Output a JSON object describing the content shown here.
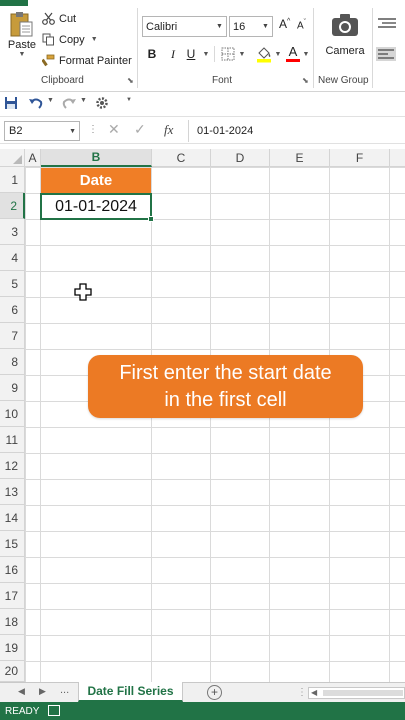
{
  "ribbon": {
    "clipboard": {
      "paste_label": "Paste",
      "cut_label": "Cut",
      "copy_label": "Copy",
      "format_painter_label": "Format Painter",
      "group_label": "Clipboard"
    },
    "font": {
      "font_name": "Calibri",
      "font_size": "16",
      "bold_label": "B",
      "italic_label": "I",
      "underline_label": "U",
      "grow_label": "A",
      "shrink_label": "A",
      "font_color_label": "A",
      "group_label": "Font",
      "highlight_color": "#ffff00",
      "font_color": "#ff0000"
    },
    "new_group": {
      "camera_label": "Camera",
      "group_label": "New Group"
    }
  },
  "formula_bar": {
    "name_box": "B2",
    "fx_label": "fx",
    "formula": "01-01-2024"
  },
  "grid": {
    "columns": [
      "A",
      "B",
      "C",
      "D",
      "E",
      "F"
    ],
    "rows": [
      "1",
      "2",
      "3",
      "4",
      "5",
      "6",
      "7",
      "8",
      "9",
      "10",
      "11",
      "12",
      "13",
      "14",
      "15",
      "16",
      "17",
      "18",
      "19",
      "20"
    ],
    "active_column": "B",
    "active_row": "2",
    "cell_b1": "Date",
    "cell_b2": "01-01-2024"
  },
  "callout": {
    "line1": "First enter the start date",
    "line2": "in the first cell",
    "color": "#ec7a24"
  },
  "sheet_tabs": {
    "ellipsis": "...",
    "active_tab": "Date Fill Series"
  },
  "status_bar": {
    "ready_label": "READY"
  },
  "colors": {
    "excel_green": "#217346",
    "header_fill": "#f07e26"
  }
}
